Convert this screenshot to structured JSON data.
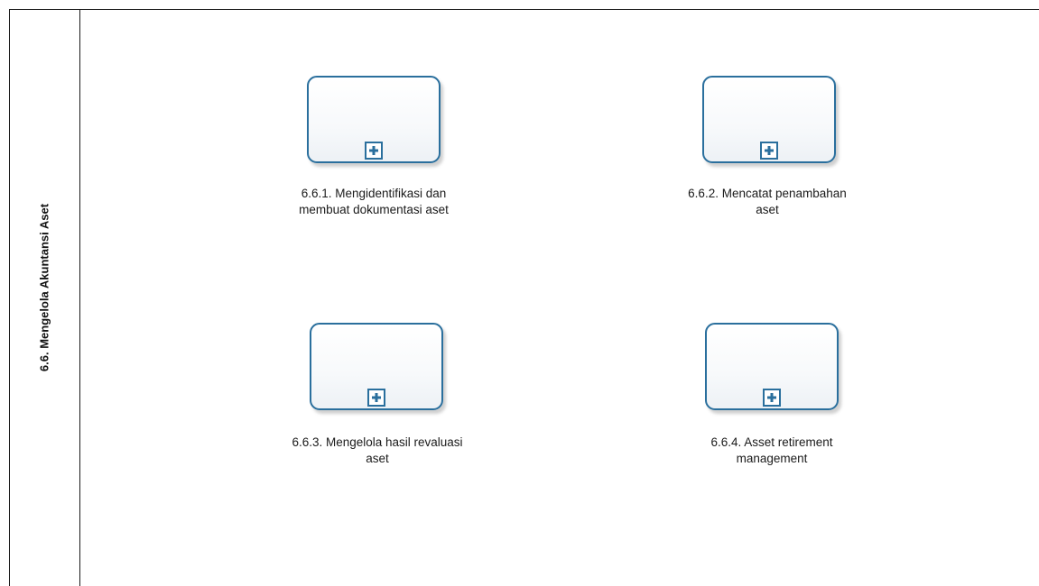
{
  "lane": {
    "title": "6.6. Mengelola Akuntansi Aset"
  },
  "tasks": [
    {
      "label": "6.6.1. Mengidentifikasi dan\nmembuat dokumentasi aset",
      "marker": "plus-icon"
    },
    {
      "label": "6.6.2. Mencatat  penambahan\naset",
      "marker": "plus-icon"
    },
    {
      "label": "6.6.3.  Mengelola hasil revaluasi\naset",
      "marker": "plus-icon"
    },
    {
      "label": "6.6.4. Asset retirement\nmanagement",
      "marker": "plus-icon"
    }
  ],
  "colors": {
    "task_border": "#2a6f9d",
    "line": "#1a1a1a"
  }
}
